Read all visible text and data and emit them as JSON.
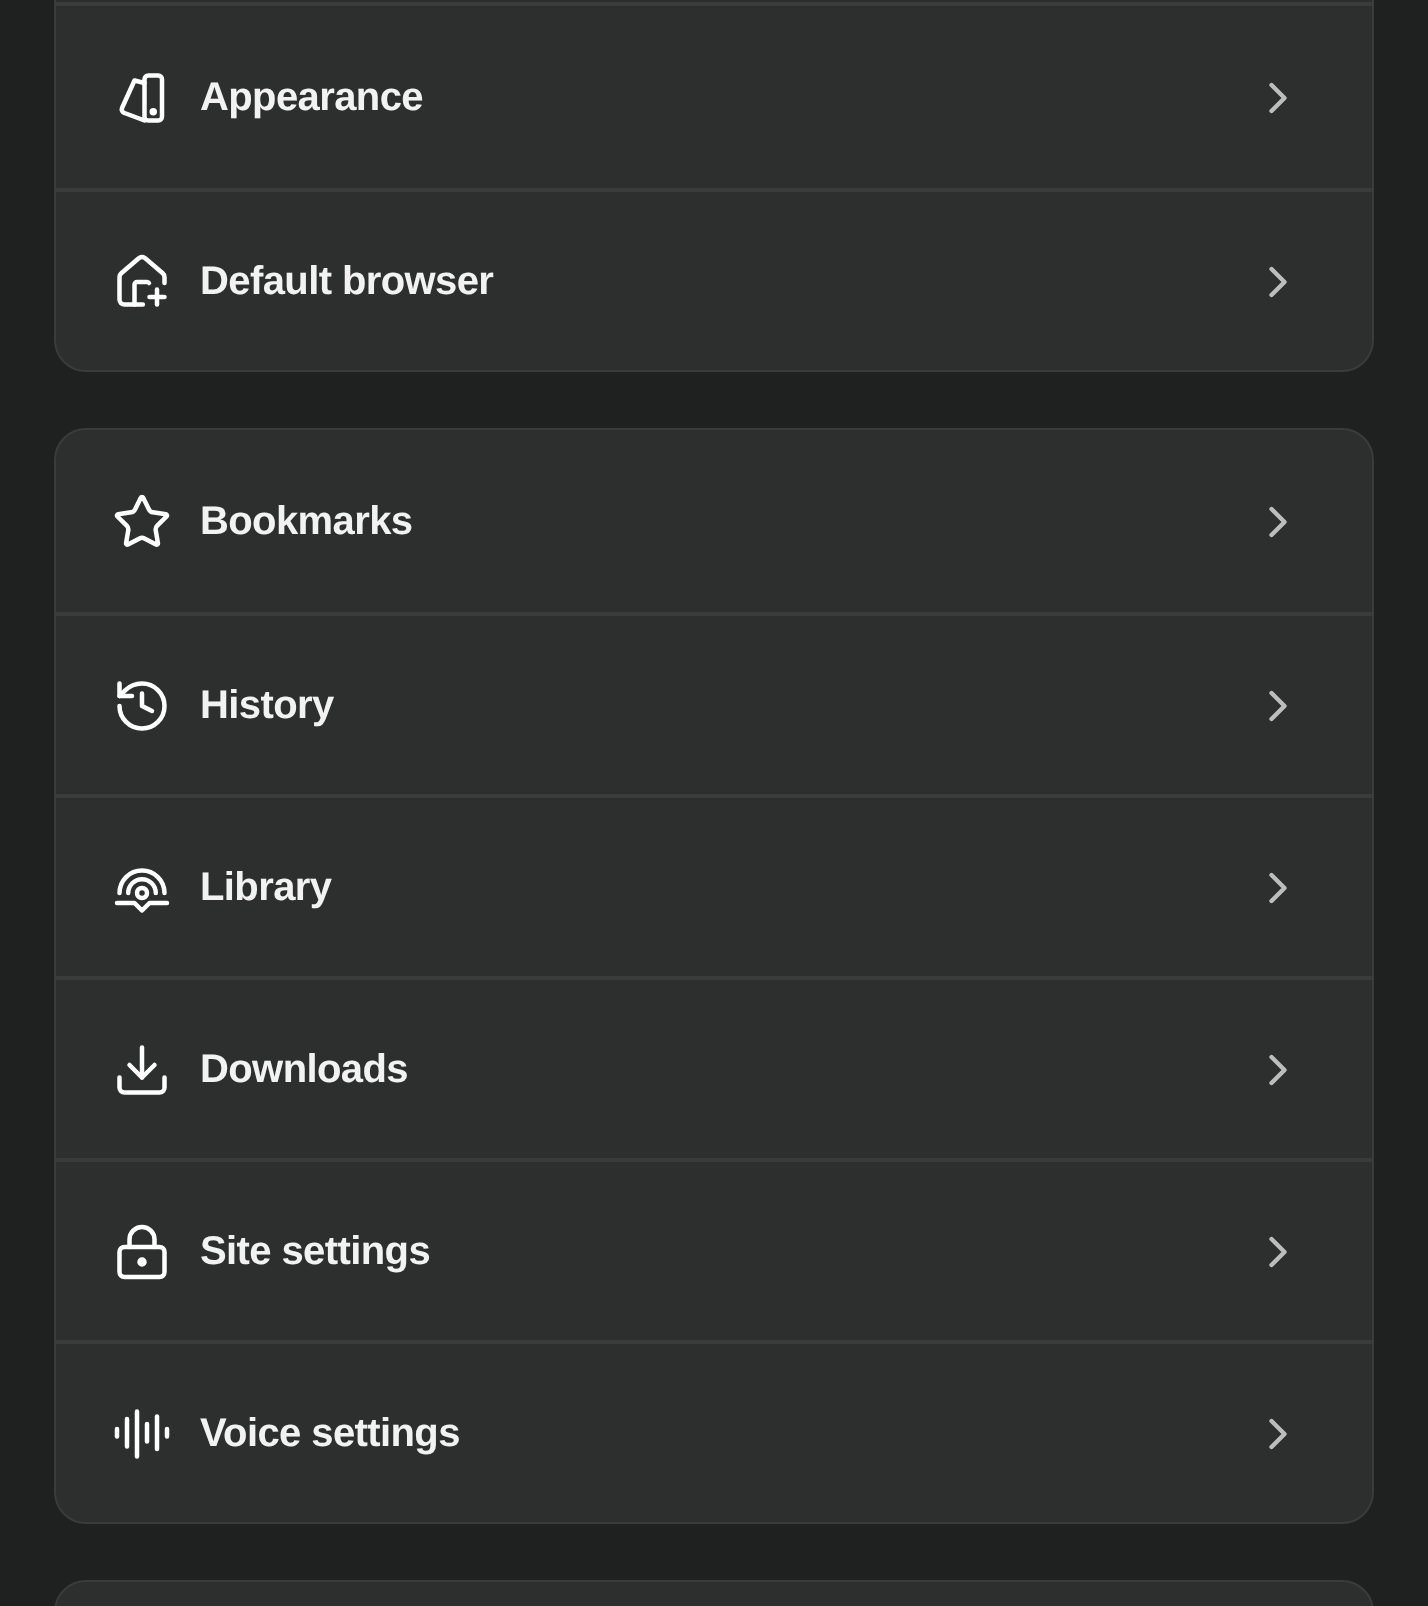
{
  "groups": [
    {
      "items": [
        {
          "label": "Appearance"
        },
        {
          "label": "Default browser"
        }
      ]
    },
    {
      "items": [
        {
          "label": "Bookmarks"
        },
        {
          "label": "History"
        },
        {
          "label": "Library"
        },
        {
          "label": "Downloads"
        },
        {
          "label": "Site settings"
        },
        {
          "label": "Voice settings"
        }
      ]
    }
  ]
}
